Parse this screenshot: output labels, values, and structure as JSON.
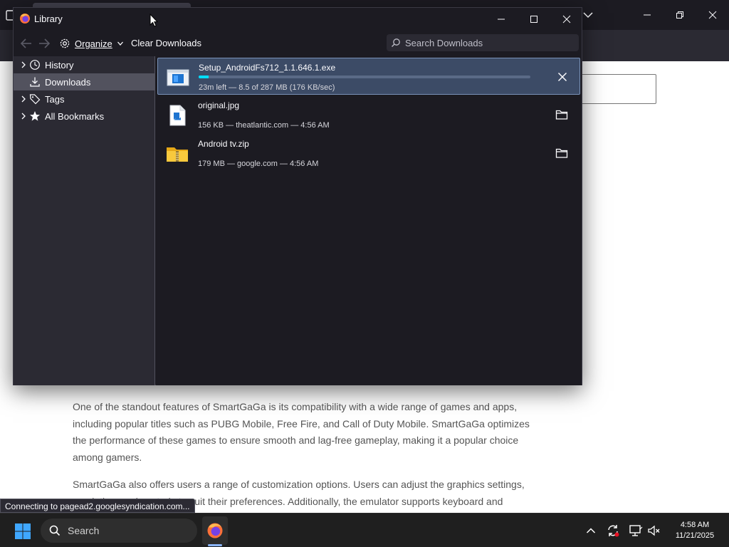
{
  "browser": {
    "titlebar_color": "#1c1b22",
    "toolbar_color": "#2b2a33"
  },
  "article": {
    "paragraph_1": "One of the standout features of SmartGaGa is its compatibility with a wide range of games and apps, including popular titles such as PUBG Mobile, Free Fire, and Call of Duty Mobile. SmartGaGa optimizes the performance of these games to ensure smooth and lag-free gameplay, making it a popular choice among gamers.",
    "paragraph_2": "SmartGaGa also offers users a range of customization options. Users can adjust the graphics settings, resolution, and controls to suit their preferences. Additionally, the emulator supports keyboard and"
  },
  "status_bar": {
    "text": "Connecting to pagead2.googlesyndication.com..."
  },
  "library": {
    "title": "Library",
    "toolbar": {
      "organize_label": "Organize",
      "clear_downloads_label": "Clear Downloads",
      "search_placeholder": "Search Downloads"
    },
    "sidebar": [
      {
        "label": "History",
        "icon": "clock-icon",
        "expandable": true,
        "selected": false
      },
      {
        "label": "Downloads",
        "icon": "download-icon",
        "expandable": false,
        "selected": true
      },
      {
        "label": "Tags",
        "icon": "tag-icon",
        "expandable": true,
        "selected": false
      },
      {
        "label": "All Bookmarks",
        "icon": "star-icon",
        "expandable": true,
        "selected": false
      }
    ],
    "downloads": [
      {
        "name": "Setup_AndroidFs712_1.1.646.1.exe",
        "status": "23m left — 8.5 of 287 MB (176 KB/sec)",
        "progress": 0.03,
        "icon": "installer-icon",
        "action": "cancel-icon",
        "selected": true
      },
      {
        "name": "original.jpg",
        "status": "156 KB — theatlantic.com — 4:56 AM",
        "icon": "image-file-icon",
        "action": "folder-icon",
        "selected": false
      },
      {
        "name": "Android tv.zip",
        "status": "179 MB — google.com — 4:56 AM",
        "icon": "zip-folder-icon",
        "action": "folder-icon",
        "selected": false
      }
    ],
    "accent_color": "#00ddff",
    "selected_row_color": "#3c4b66"
  },
  "taskbar": {
    "search_label": "Search",
    "time": "4:58 AM",
    "date": "11/21/2025"
  }
}
